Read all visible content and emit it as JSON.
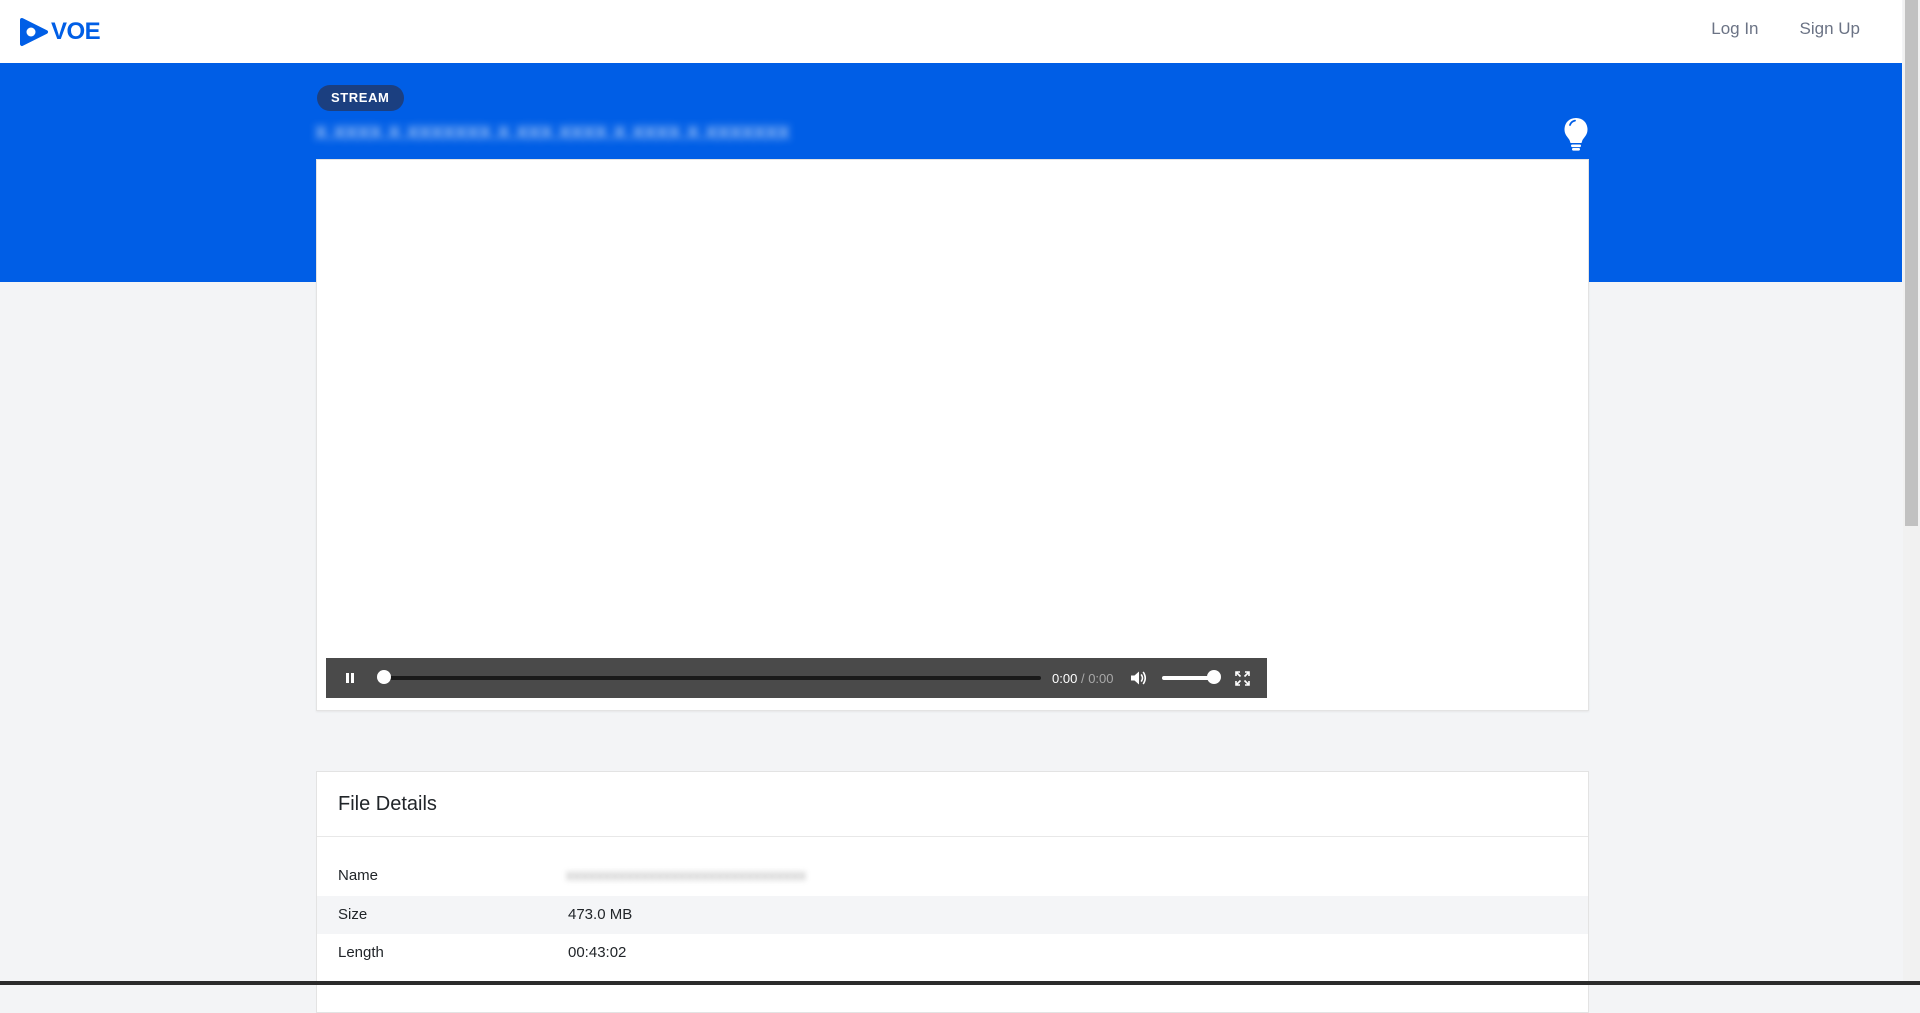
{
  "brand": {
    "name": "VOE",
    "color": "#005ee6"
  },
  "nav": {
    "login_label": "Log In",
    "signup_label": "Sign Up"
  },
  "hero": {
    "badge_label": "STREAM",
    "title_blurred": "x.xxxx.x.xxxxxxx.x.xxx.xxxx.x.xxxx.x.xxxxxxx",
    "background_color": "#005ee6",
    "theater_icon": "lightbulb-icon"
  },
  "player": {
    "current_time": "0:00",
    "separator": "/",
    "duration": "0:00",
    "progress_fraction": 0.0,
    "volume_fraction": 1.0,
    "icons": [
      "pause-icon",
      "volume-icon",
      "fullscreen-icon"
    ]
  },
  "details": {
    "title": "File Details",
    "rows": [
      {
        "key": "Name",
        "value": "xxxxxxxxxxxxxxxxxxxxxxxxxxxxxxxx"
      },
      {
        "key": "Size",
        "value": "473.0 MB"
      },
      {
        "key": "Length",
        "value": "00:43:02"
      }
    ]
  }
}
